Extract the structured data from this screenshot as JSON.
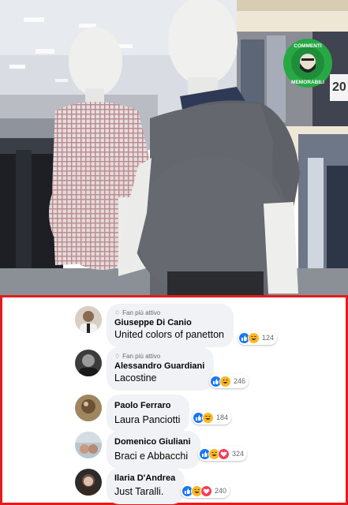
{
  "badge": {
    "top_text": "COMMENTI",
    "bottom_text": "MEMORABILI",
    "color": "#27a844"
  },
  "store_sign": "20",
  "comments": [
    {
      "fan_label": "Fan più attivo",
      "name": "Giuseppe Di Canio",
      "text": "United colors of panetton",
      "reactions": [
        "like-icon",
        "haha-icon"
      ],
      "count": "124"
    },
    {
      "fan_label": "Fan più attivo",
      "name": "Alessandro Guardiani",
      "text": "Lacostine",
      "reactions": [
        "like-icon",
        "haha-icon"
      ],
      "count": "246"
    },
    {
      "fan_label": "",
      "name": "Paolo Ferraro",
      "text": "Laura Panciotti",
      "reactions": [
        "like-icon",
        "haha-icon"
      ],
      "count": "184"
    },
    {
      "fan_label": "",
      "name": "Domenico Giuliani",
      "text": "Braci e Abbacchi",
      "reactions": [
        "like-icon",
        "haha-icon",
        "love-icon"
      ],
      "count": "324"
    },
    {
      "fan_label": "",
      "name": "Ilaria D'Andrea",
      "text": "Just Taralli.",
      "reactions": [
        "like-icon",
        "haha-icon",
        "love-icon"
      ],
      "count": "240"
    }
  ],
  "colors": {
    "frame": "#e41b1b",
    "like": "#1877f2",
    "haha": "#f7b928",
    "love": "#f33e58",
    "bubble": "#f0f2f5"
  }
}
